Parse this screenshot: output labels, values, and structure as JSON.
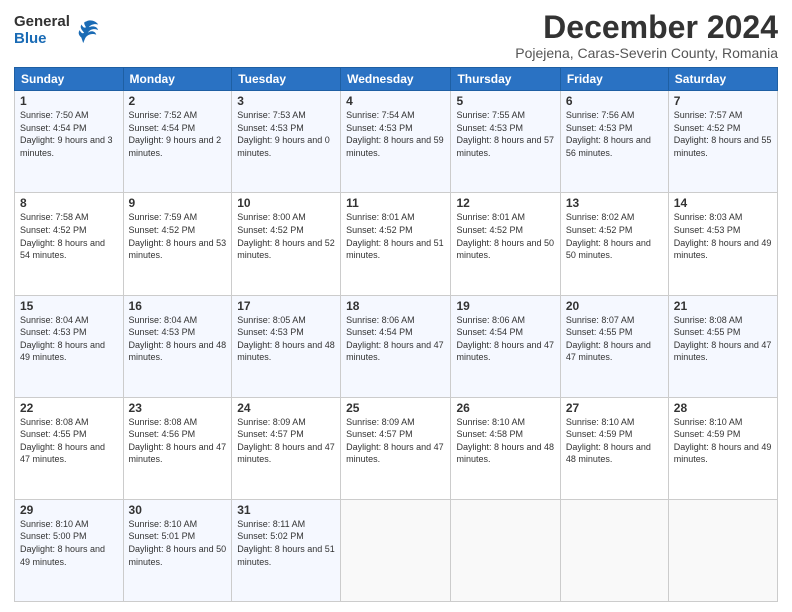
{
  "header": {
    "logo_line1": "General",
    "logo_line2": "Blue",
    "month": "December 2024",
    "location": "Pojejena, Caras-Severin County, Romania"
  },
  "days_of_week": [
    "Sunday",
    "Monday",
    "Tuesday",
    "Wednesday",
    "Thursday",
    "Friday",
    "Saturday"
  ],
  "weeks": [
    [
      {
        "day": "1",
        "sunrise": "7:50 AM",
        "sunset": "4:54 PM",
        "daylight": "9 hours and 3 minutes."
      },
      {
        "day": "2",
        "sunrise": "7:52 AM",
        "sunset": "4:54 PM",
        "daylight": "9 hours and 2 minutes."
      },
      {
        "day": "3",
        "sunrise": "7:53 AM",
        "sunset": "4:53 PM",
        "daylight": "9 hours and 0 minutes."
      },
      {
        "day": "4",
        "sunrise": "7:54 AM",
        "sunset": "4:53 PM",
        "daylight": "8 hours and 59 minutes."
      },
      {
        "day": "5",
        "sunrise": "7:55 AM",
        "sunset": "4:53 PM",
        "daylight": "8 hours and 57 minutes."
      },
      {
        "day": "6",
        "sunrise": "7:56 AM",
        "sunset": "4:53 PM",
        "daylight": "8 hours and 56 minutes."
      },
      {
        "day": "7",
        "sunrise": "7:57 AM",
        "sunset": "4:52 PM",
        "daylight": "8 hours and 55 minutes."
      }
    ],
    [
      {
        "day": "8",
        "sunrise": "7:58 AM",
        "sunset": "4:52 PM",
        "daylight": "8 hours and 54 minutes."
      },
      {
        "day": "9",
        "sunrise": "7:59 AM",
        "sunset": "4:52 PM",
        "daylight": "8 hours and 53 minutes."
      },
      {
        "day": "10",
        "sunrise": "8:00 AM",
        "sunset": "4:52 PM",
        "daylight": "8 hours and 52 minutes."
      },
      {
        "day": "11",
        "sunrise": "8:01 AM",
        "sunset": "4:52 PM",
        "daylight": "8 hours and 51 minutes."
      },
      {
        "day": "12",
        "sunrise": "8:01 AM",
        "sunset": "4:52 PM",
        "daylight": "8 hours and 50 minutes."
      },
      {
        "day": "13",
        "sunrise": "8:02 AM",
        "sunset": "4:52 PM",
        "daylight": "8 hours and 50 minutes."
      },
      {
        "day": "14",
        "sunrise": "8:03 AM",
        "sunset": "4:53 PM",
        "daylight": "8 hours and 49 minutes."
      }
    ],
    [
      {
        "day": "15",
        "sunrise": "8:04 AM",
        "sunset": "4:53 PM",
        "daylight": "8 hours and 49 minutes."
      },
      {
        "day": "16",
        "sunrise": "8:04 AM",
        "sunset": "4:53 PM",
        "daylight": "8 hours and 48 minutes."
      },
      {
        "day": "17",
        "sunrise": "8:05 AM",
        "sunset": "4:53 PM",
        "daylight": "8 hours and 48 minutes."
      },
      {
        "day": "18",
        "sunrise": "8:06 AM",
        "sunset": "4:54 PM",
        "daylight": "8 hours and 47 minutes."
      },
      {
        "day": "19",
        "sunrise": "8:06 AM",
        "sunset": "4:54 PM",
        "daylight": "8 hours and 47 minutes."
      },
      {
        "day": "20",
        "sunrise": "8:07 AM",
        "sunset": "4:55 PM",
        "daylight": "8 hours and 47 minutes."
      },
      {
        "day": "21",
        "sunrise": "8:08 AM",
        "sunset": "4:55 PM",
        "daylight": "8 hours and 47 minutes."
      }
    ],
    [
      {
        "day": "22",
        "sunrise": "8:08 AM",
        "sunset": "4:55 PM",
        "daylight": "8 hours and 47 minutes."
      },
      {
        "day": "23",
        "sunrise": "8:08 AM",
        "sunset": "4:56 PM",
        "daylight": "8 hours and 47 minutes."
      },
      {
        "day": "24",
        "sunrise": "8:09 AM",
        "sunset": "4:57 PM",
        "daylight": "8 hours and 47 minutes."
      },
      {
        "day": "25",
        "sunrise": "8:09 AM",
        "sunset": "4:57 PM",
        "daylight": "8 hours and 47 minutes."
      },
      {
        "day": "26",
        "sunrise": "8:10 AM",
        "sunset": "4:58 PM",
        "daylight": "8 hours and 48 minutes."
      },
      {
        "day": "27",
        "sunrise": "8:10 AM",
        "sunset": "4:59 PM",
        "daylight": "8 hours and 48 minutes."
      },
      {
        "day": "28",
        "sunrise": "8:10 AM",
        "sunset": "4:59 PM",
        "daylight": "8 hours and 49 minutes."
      }
    ],
    [
      {
        "day": "29",
        "sunrise": "8:10 AM",
        "sunset": "5:00 PM",
        "daylight": "8 hours and 49 minutes."
      },
      {
        "day": "30",
        "sunrise": "8:10 AM",
        "sunset": "5:01 PM",
        "daylight": "8 hours and 50 minutes."
      },
      {
        "day": "31",
        "sunrise": "8:11 AM",
        "sunset": "5:02 PM",
        "daylight": "8 hours and 51 minutes."
      },
      null,
      null,
      null,
      null
    ]
  ]
}
